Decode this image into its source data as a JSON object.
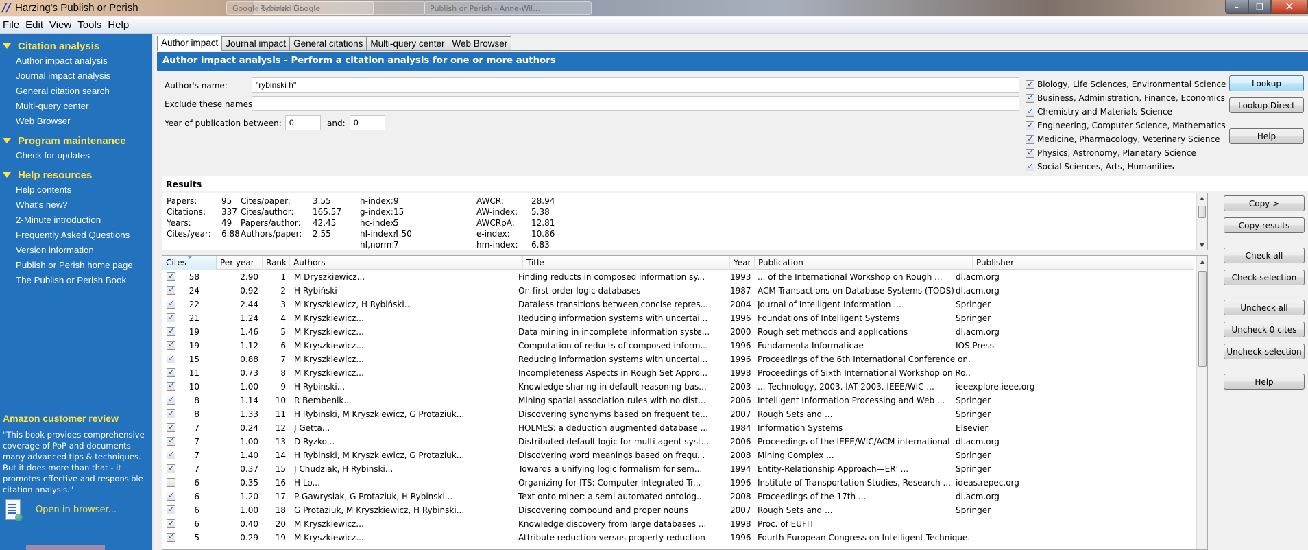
{
  "window": {
    "title": "Harzing's Publish or Perish",
    "background_tabs": [
      "Google Scholar Cit...",
      "Rybinski Google",
      "Publish or Perish - Anne-Wil..."
    ],
    "controls": {
      "minimize": "–",
      "maximize": "❐",
      "close": "✕"
    }
  },
  "menu": [
    "File",
    "Edit",
    "View",
    "Tools",
    "Help"
  ],
  "sidebar": {
    "groups": [
      {
        "title": "Citation analysis",
        "items": [
          "Author impact analysis",
          "Journal impact analysis",
          "General citation search",
          "Multi-query center",
          "Web Browser"
        ]
      },
      {
        "title": "Program maintenance",
        "items": [
          "Check for updates"
        ]
      },
      {
        "title": "Help resources",
        "items": [
          "Help contents",
          "What's new?",
          "2-Minute introduction",
          "Frequently Asked Questions",
          "Version information",
          "Publish or Perish home page",
          "The Publish or Perish Book"
        ]
      }
    ],
    "review": {
      "title": "Amazon customer review",
      "text": "\"This book provides comprehensive coverage of PoP and documents many advanced tips & techniques. But it does more than that - it promotes effective and responsible citation analysis.\"",
      "open_link": "Open in browser..."
    }
  },
  "tabs": [
    "Author impact",
    "Journal impact",
    "General citations",
    "Multi-query center",
    "Web Browser"
  ],
  "active_tab": "Author impact",
  "header": "Author impact analysis - Perform a citation analysis for one or more authors",
  "form": {
    "author_label": "Author's name:",
    "author_value": "\"rybinski h\"",
    "exclude_label": "Exclude these names:",
    "exclude_value": "",
    "year_label": "Year of publication between:",
    "year_from": "0",
    "and_label": "and:",
    "year_to": "0"
  },
  "subjects": [
    {
      "label": "Biology, Life Sciences, Environmental Science",
      "checked": true
    },
    {
      "label": "Business, Administration, Finance, Economics",
      "checked": true
    },
    {
      "label": "Chemistry and Materials Science",
      "checked": true
    },
    {
      "label": "Engineering, Computer Science, Mathematics",
      "checked": true
    },
    {
      "label": "Medicine, Pharmacology, Veterinary Science",
      "checked": true
    },
    {
      "label": "Physics, Astronomy, Planetary Science",
      "checked": true
    },
    {
      "label": "Social Sciences, Arts, Humanities",
      "checked": true
    }
  ],
  "buttons": {
    "lookup": "Lookup",
    "lookup_direct": "Lookup Direct",
    "help_top": "Help",
    "copy": "Copy >",
    "copy_results": "Copy results",
    "check_all": "Check all",
    "check_selection": "Check selection",
    "uncheck_all": "Uncheck all",
    "uncheck_zero": "Uncheck 0 cites",
    "uncheck_selection": "Uncheck selection",
    "help_bottom": "Help"
  },
  "results": {
    "title": "Results",
    "stats": [
      [
        {
          "k": "Papers:",
          "v": "95"
        },
        {
          "k": "Citations:",
          "v": "337"
        },
        {
          "k": "Years:",
          "v": "49"
        },
        {
          "k": "Cites/year:",
          "v": "6.88"
        }
      ],
      [
        {
          "k": "Cites/paper:",
          "v": "3.55"
        },
        {
          "k": "Cites/author:",
          "v": "165.57"
        },
        {
          "k": "Papers/author:",
          "v": "42.45"
        },
        {
          "k": "Authors/paper:",
          "v": "2.55"
        }
      ],
      [
        {
          "k": "h-index:",
          "v": "9"
        },
        {
          "k": "g-index:",
          "v": "15"
        },
        {
          "k": "hc-index:",
          "v": "5"
        },
        {
          "k": "hI-index:",
          "v": "4.50"
        },
        {
          "k": "hI,norm:",
          "v": "7"
        }
      ],
      [
        {
          "k": "AWCR:",
          "v": "28.94"
        },
        {
          "k": "AW-index:",
          "v": "5.38"
        },
        {
          "k": "AWCRpA:",
          "v": "12.81"
        },
        {
          "k": "e-index:",
          "v": "10.86"
        },
        {
          "k": "hm-index:",
          "v": "6.83"
        }
      ]
    ]
  },
  "table": {
    "columns": [
      "Cites",
      "Per year",
      "Rank",
      "Authors",
      "Title",
      "Year",
      "Publication",
      "Publisher"
    ],
    "sorted_by": "Cites",
    "rows": [
      {
        "checked": true,
        "cites": "58",
        "per_year": "2.90",
        "rank": "1",
        "authors": "M Dryszkiewicz...",
        "title": "Finding reducts in composed information sy...",
        "year": "1993",
        "publication": "... of the International Workshop on Rough ...",
        "publisher": "dl.acm.org"
      },
      {
        "checked": true,
        "cites": "24",
        "per_year": "0.92",
        "rank": "2",
        "authors": "H Rybiński",
        "title": "On first-order-logic databases",
        "year": "1987",
        "publication": "ACM Transactions on Database Systems (TODS)",
        "publisher": "dl.acm.org"
      },
      {
        "checked": true,
        "cites": "22",
        "per_year": "2.44",
        "rank": "3",
        "authors": "M Kryszkiewicz, H Rybiński...",
        "title": "Dataless transitions between concise repres...",
        "year": "2004",
        "publication": "Journal of Intelligent Information ...",
        "publisher": "Springer"
      },
      {
        "checked": true,
        "cites": "21",
        "per_year": "1.24",
        "rank": "4",
        "authors": "M Kryszkiewicz...",
        "title": "Reducing information systems with uncertai...",
        "year": "1996",
        "publication": "Foundations of Intelligent Systems",
        "publisher": "Springer"
      },
      {
        "checked": true,
        "cites": "19",
        "per_year": "1.46",
        "rank": "5",
        "authors": "M Kryszkiewicz...",
        "title": "Data mining in incomplete information syste...",
        "year": "2000",
        "publication": "Rough set methods and applications",
        "publisher": "dl.acm.org"
      },
      {
        "checked": true,
        "cites": "19",
        "per_year": "1.12",
        "rank": "6",
        "authors": "M Kryszkiewicz...",
        "title": "Computation of reducts of composed inform...",
        "year": "1996",
        "publication": "Fundamenta Informaticae",
        "publisher": "IOS Press"
      },
      {
        "checked": true,
        "cites": "15",
        "per_year": "0.88",
        "rank": "7",
        "authors": "M Kryszkiewicz...",
        "title": "Reducing information systems with uncertai...",
        "year": "1996",
        "publication": "Proceedings of the 6th International Conference on...",
        "publisher": ""
      },
      {
        "checked": true,
        "cites": "11",
        "per_year": "0.73",
        "rank": "8",
        "authors": "M Kryszkiewicz...",
        "title": "Incompleteness Aspects in Rough Set Appro...",
        "year": "1998",
        "publication": "Proceedings of Sixth International Workshop on Ro...",
        "publisher": ""
      },
      {
        "checked": true,
        "cites": "10",
        "per_year": "1.00",
        "rank": "9",
        "authors": "H Rybinski...",
        "title": "Knowledge sharing in default reasoning bas...",
        "year": "2003",
        "publication": "... Technology, 2003. IAT 2003. IEEE/WIC ...",
        "publisher": "ieeexplore.ieee.org"
      },
      {
        "checked": true,
        "cites": "8",
        "per_year": "1.14",
        "rank": "10",
        "authors": "R Bembenik...",
        "title": "Mining spatial association rules with no dist...",
        "year": "2006",
        "publication": "Intelligent Information Processing and Web ...",
        "publisher": "Springer"
      },
      {
        "checked": true,
        "cites": "8",
        "per_year": "1.33",
        "rank": "11",
        "authors": "H Rybinski, M Kryszkiewicz, G Protaziuk...",
        "title": "Discovering synonyms based on frequent te...",
        "year": "2007",
        "publication": "Rough Sets and ...",
        "publisher": "Springer"
      },
      {
        "checked": true,
        "cites": "7",
        "per_year": "0.24",
        "rank": "12",
        "authors": "J Getta...",
        "title": "HOLMES: a deduction augmented database ...",
        "year": "1984",
        "publication": "Information Systems",
        "publisher": "Elsevier"
      },
      {
        "checked": true,
        "cites": "7",
        "per_year": "1.00",
        "rank": "13",
        "authors": "D Ryzko...",
        "title": "Distributed default logic for multi-agent syst...",
        "year": "2006",
        "publication": "Proceedings of the IEEE/WIC/ACM international ...",
        "publisher": "dl.acm.org"
      },
      {
        "checked": true,
        "cites": "7",
        "per_year": "1.40",
        "rank": "14",
        "authors": "H Rybinski, M Kryszkiewicz, G Protaziuk...",
        "title": "Discovering word meanings based on frequ...",
        "year": "2008",
        "publication": "Mining Complex ...",
        "publisher": "Springer"
      },
      {
        "checked": true,
        "cites": "7",
        "per_year": "0.37",
        "rank": "15",
        "authors": "J Chudziak, H Rybinski...",
        "title": "Towards a unifying logic formalism for sem...",
        "year": "1994",
        "publication": "Entity-Relationship Approach—ER' ...",
        "publisher": "Springer"
      },
      {
        "checked": false,
        "cites": "6",
        "per_year": "0.35",
        "rank": "16",
        "authors": "H Lo...",
        "title": "Organizing for ITS: Computer Integrated Tr...",
        "year": "1996",
        "publication": "Institute of Transportation Studies, Research ...",
        "publisher": "ideas.repec.org"
      },
      {
        "checked": true,
        "cites": "6",
        "per_year": "1.20",
        "rank": "17",
        "authors": "P Gawrysiak, G Protaziuk, H Rybinski...",
        "title": "Text onto miner: a semi automated ontolog...",
        "year": "2008",
        "publication": "Proceedings of the 17th ...",
        "publisher": "dl.acm.org"
      },
      {
        "checked": true,
        "cites": "6",
        "per_year": "1.00",
        "rank": "18",
        "authors": "G Protaziuk, M Kryszkiewicz, H Rybinski...",
        "title": "Discovering compound and proper nouns",
        "year": "2007",
        "publication": "Rough Sets and ...",
        "publisher": "Springer"
      },
      {
        "checked": true,
        "cites": "6",
        "per_year": "0.40",
        "rank": "20",
        "authors": "M Kryszkiewicz...",
        "title": "Knowledge discovery from large databases ...",
        "year": "1998",
        "publication": "Proc. of EUFIT",
        "publisher": ""
      },
      {
        "checked": true,
        "cites": "5",
        "per_year": "0.29",
        "rank": "19",
        "authors": "M Kryszkiewicz...",
        "title": "Attribute reduction versus property reduction",
        "year": "1996",
        "publication": "Fourth European Congress on Intelligent Technique...",
        "publisher": ""
      }
    ]
  }
}
